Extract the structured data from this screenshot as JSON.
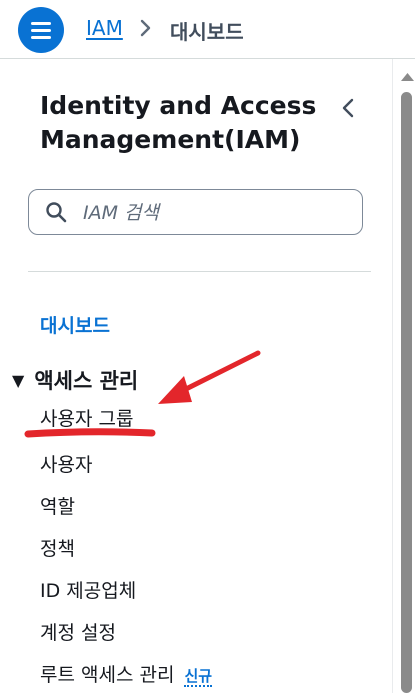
{
  "header": {
    "breadcrumb_link": "IAM",
    "breadcrumb_current": "대시보드"
  },
  "sidebar": {
    "title": "Identity and Access Management(IAM)",
    "search_placeholder": "IAM 검색",
    "dashboard_link": "대시보드",
    "section_title": "액세스 관리",
    "items": [
      {
        "label": "사용자 그룹"
      },
      {
        "label": "사용자"
      },
      {
        "label": "역할"
      },
      {
        "label": "정책"
      },
      {
        "label": "ID 제공업체"
      },
      {
        "label": "계정 설정"
      },
      {
        "label": "루트 액세스 관리",
        "badge": "신규"
      }
    ]
  },
  "colors": {
    "accent": "#0972d3",
    "annotation": "#e3262b"
  }
}
